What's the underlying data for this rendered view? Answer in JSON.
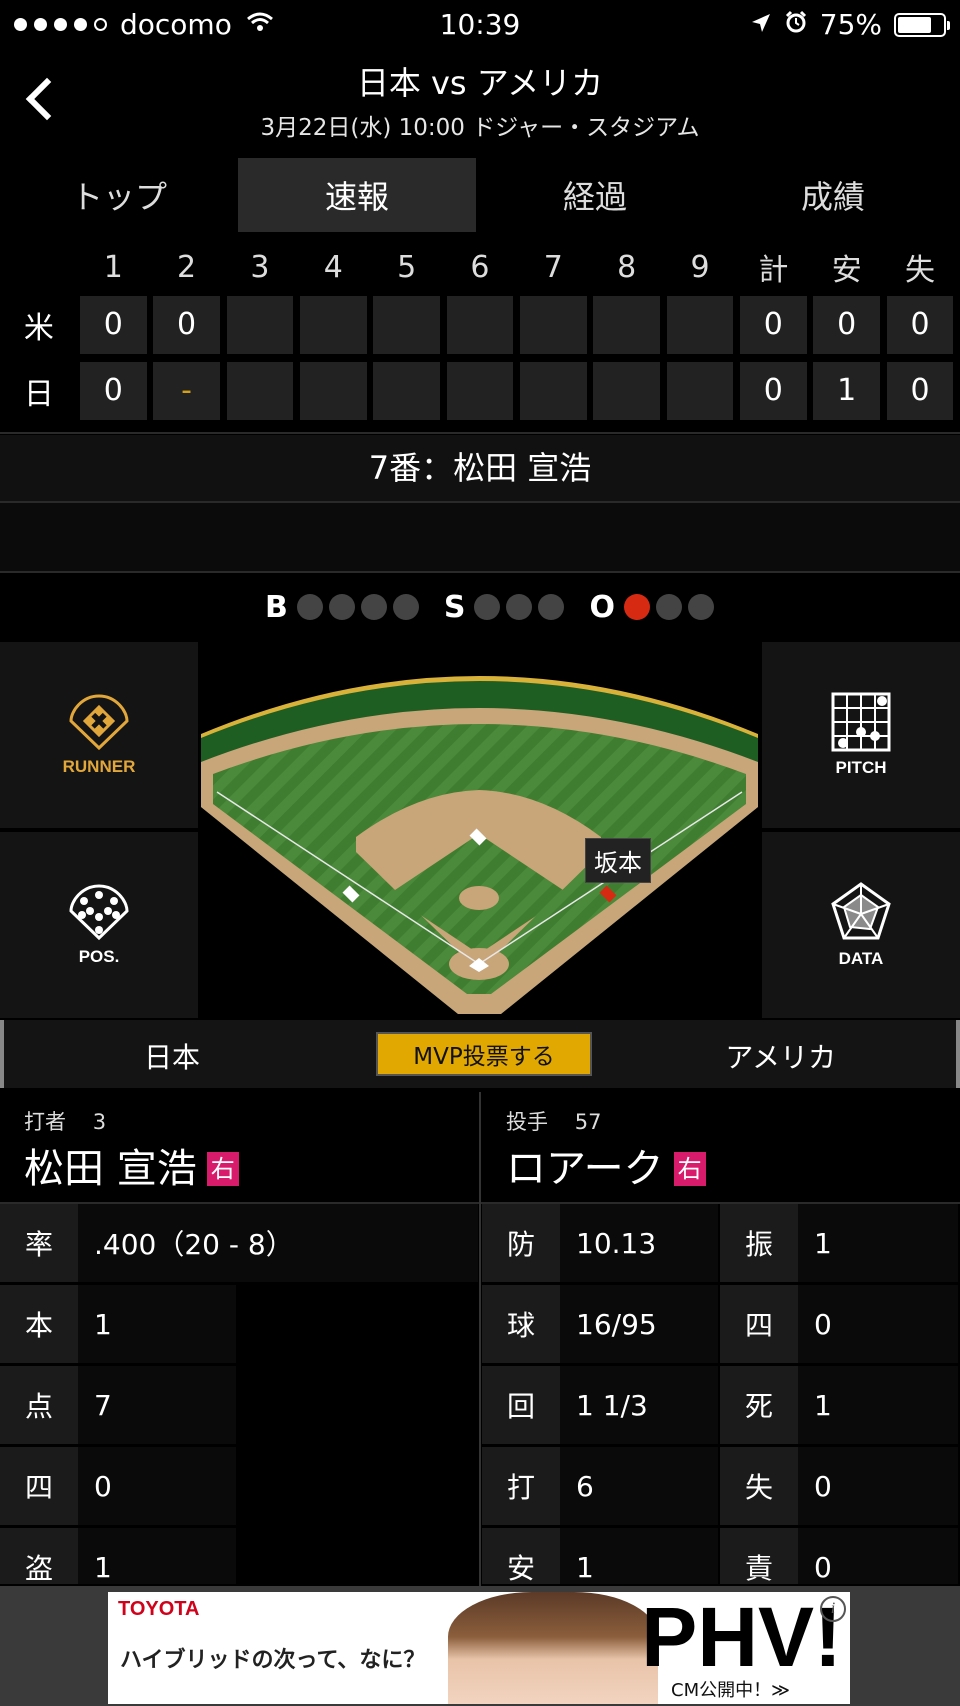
{
  "status_bar": {
    "carrier": "docomo",
    "time": "10:39",
    "battery_text": "75%",
    "battery_level": 0.75
  },
  "header": {
    "title": "日本 vs アメリカ",
    "subtitle": "3月22日(水) 10:00 ドジャー・スタジアム"
  },
  "tabs": [
    {
      "label": "トップ",
      "active": false
    },
    {
      "label": "速報",
      "active": true
    },
    {
      "label": "経過",
      "active": false
    },
    {
      "label": "成績",
      "active": false
    }
  ],
  "scoreboard": {
    "columns": [
      "1",
      "2",
      "3",
      "4",
      "5",
      "6",
      "7",
      "8",
      "9",
      "計",
      "安",
      "失"
    ],
    "rows": [
      {
        "team": "米",
        "cells": [
          "0",
          "0",
          "",
          "",
          "",
          "",
          "",
          "",
          "",
          "0",
          "0",
          "0"
        ]
      },
      {
        "team": "日",
        "cells": [
          "0",
          "-",
          "",
          "",
          "",
          "",
          "",
          "",
          "",
          "0",
          "1",
          "0"
        ]
      }
    ]
  },
  "current_batter_banner": "7番：松田 宣浩",
  "count": {
    "b_label": "B",
    "s_label": "S",
    "o_label": "O",
    "balls": 0,
    "strikes": 0,
    "outs": 1
  },
  "side_buttons": {
    "runner": "RUNNER",
    "pos": "POS.",
    "pitch": "PITCH",
    "data": "DATA"
  },
  "field": {
    "runner_label": "坂本"
  },
  "team_bar": {
    "left": "日本",
    "right": "アメリカ",
    "mvp": "MVP投票する"
  },
  "batter": {
    "role": "打者",
    "number": "3",
    "name": "松田 宣浩",
    "hand": "右"
  },
  "pitcher": {
    "role": "投手",
    "number": "57",
    "name": "ロアーク",
    "hand": "右"
  },
  "batter_stats": {
    "avg": {
      "k": "率",
      "v": ".400（20 - 8）"
    },
    "rows": [
      {
        "k": "本",
        "v": "1"
      },
      {
        "k": "点",
        "v": "7"
      },
      {
        "k": "四",
        "v": "0"
      },
      {
        "k": "盗",
        "v": "1"
      }
    ]
  },
  "pitcher_stats": [
    {
      "k": "防",
      "v": "10.13",
      "k2": "振",
      "v2": "1"
    },
    {
      "k": "球",
      "v": "16/95",
      "k2": "四",
      "v2": "0"
    },
    {
      "k": "回",
      "v": "1 1/3",
      "k2": "死",
      "v2": "1"
    },
    {
      "k": "打",
      "v": "6",
      "k2": "失",
      "v2": "0"
    },
    {
      "k": "安",
      "v": "1",
      "k2": "責",
      "v2": "0"
    }
  ],
  "ad": {
    "brand": "TOYOTA",
    "copy": "ハイブリッドの次って、なに？",
    "headline": "PHV!",
    "sub": "CM公開中！≫"
  }
}
